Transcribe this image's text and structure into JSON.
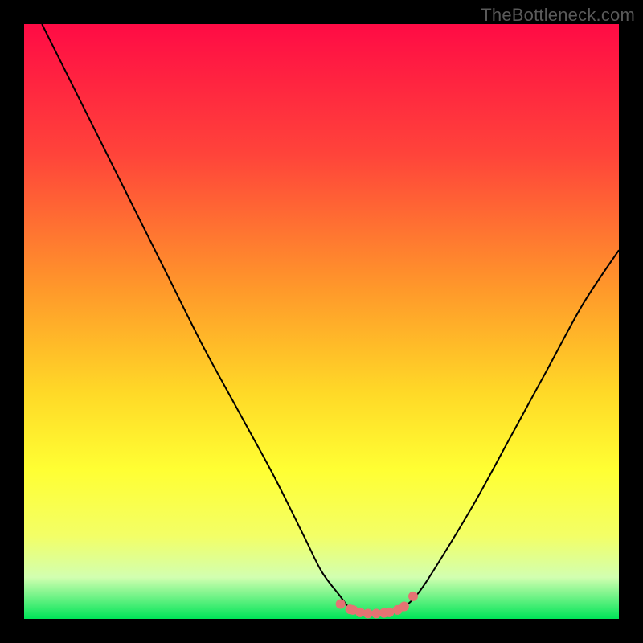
{
  "watermark": "TheBottleneck.com",
  "colors": {
    "curve": "#000000",
    "marker_fill": "#e57373",
    "marker_stroke": "#e57373",
    "bg_black": "#000000"
  },
  "chart_data": {
    "type": "line",
    "title": "",
    "xlabel": "",
    "ylabel": "",
    "xlim": [
      0,
      100
    ],
    "ylim": [
      0,
      100
    ],
    "gradient_stops": [
      {
        "offset": 0,
        "color": "#ff0b45"
      },
      {
        "offset": 22,
        "color": "#ff443a"
      },
      {
        "offset": 45,
        "color": "#ff9a2a"
      },
      {
        "offset": 62,
        "color": "#ffd927"
      },
      {
        "offset": 75,
        "color": "#ffff33"
      },
      {
        "offset": 86,
        "color": "#f3ff66"
      },
      {
        "offset": 93,
        "color": "#d2ffb0"
      },
      {
        "offset": 100,
        "color": "#00e558"
      }
    ],
    "series": [
      {
        "name": "bottleneck-curve",
        "x": [
          3,
          7,
          12,
          18,
          24,
          30,
          36,
          42,
          47,
          50,
          53,
          55,
          57,
          60,
          63,
          66,
          70,
          76,
          82,
          88,
          94,
          100
        ],
        "y": [
          100,
          92,
          82,
          70,
          58,
          46,
          35,
          24,
          14,
          8,
          4,
          1.5,
          1,
          1,
          1.5,
          4,
          10,
          20,
          31,
          42,
          53,
          62
        ]
      }
    ],
    "markers": {
      "name": "valley-markers",
      "x": [
        53.2,
        54.8,
        55.3,
        56.5,
        57.8,
        59.2,
        60.5,
        61.4,
        62.8,
        63.9,
        65.4
      ],
      "y": [
        2.5,
        1.6,
        1.5,
        1.1,
        0.9,
        0.9,
        1.0,
        1.1,
        1.5,
        2.1,
        3.8
      ],
      "radius": 5.5
    }
  }
}
